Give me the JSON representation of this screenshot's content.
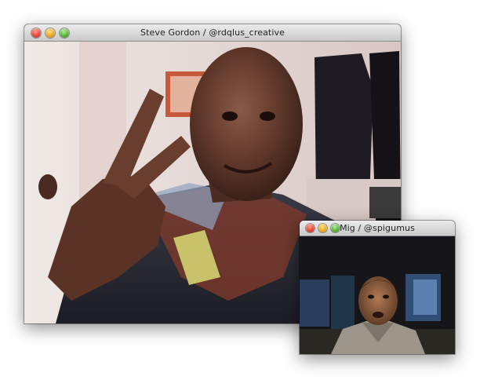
{
  "main_window": {
    "title": "Steve Gordon / @rdqlus_creative",
    "buttons": [
      "close",
      "minimize",
      "zoom"
    ],
    "video_feed": "webcam"
  },
  "mini_window": {
    "title": "Mig / @spigumus",
    "buttons": [
      "close",
      "minimize",
      "zoom"
    ],
    "video_feed": "webcam"
  },
  "colors": {
    "close": "#e0453a",
    "minimize": "#e9a81e",
    "zoom": "#58b23a",
    "titlebar": "#d6d6d6"
  }
}
